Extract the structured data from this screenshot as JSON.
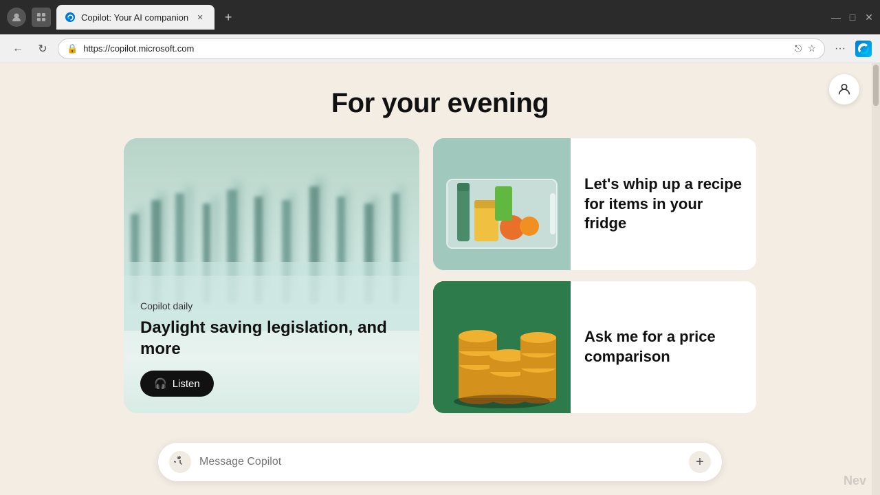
{
  "browser": {
    "tab_title": "Copilot: Your AI companion",
    "tab_url": "https://copilot.microsoft.com",
    "new_tab_label": "+",
    "back_label": "←",
    "forward_label": "→",
    "refresh_label": "↻",
    "more_label": "···",
    "minimize_label": "—",
    "maximize_label": "□",
    "close_label": "✕"
  },
  "page": {
    "heading": "For your evening"
  },
  "card_large": {
    "category": "Copilot daily",
    "title": "Daylight saving legislation, and more",
    "listen_label": "Listen"
  },
  "card_fridge": {
    "text": "Let's whip up a recipe for items in your fridge"
  },
  "card_coins": {
    "text": "Ask me for a price comparison"
  },
  "message_bar": {
    "placeholder": "Message Copilot",
    "history_icon": "⟳",
    "plus_icon": "+"
  },
  "colors": {
    "accent_blue": "#0078d4",
    "page_bg": "#f3ede4",
    "card_large_bg_top": "#b8d4c8",
    "coins_bg": "#2d7a4a"
  }
}
